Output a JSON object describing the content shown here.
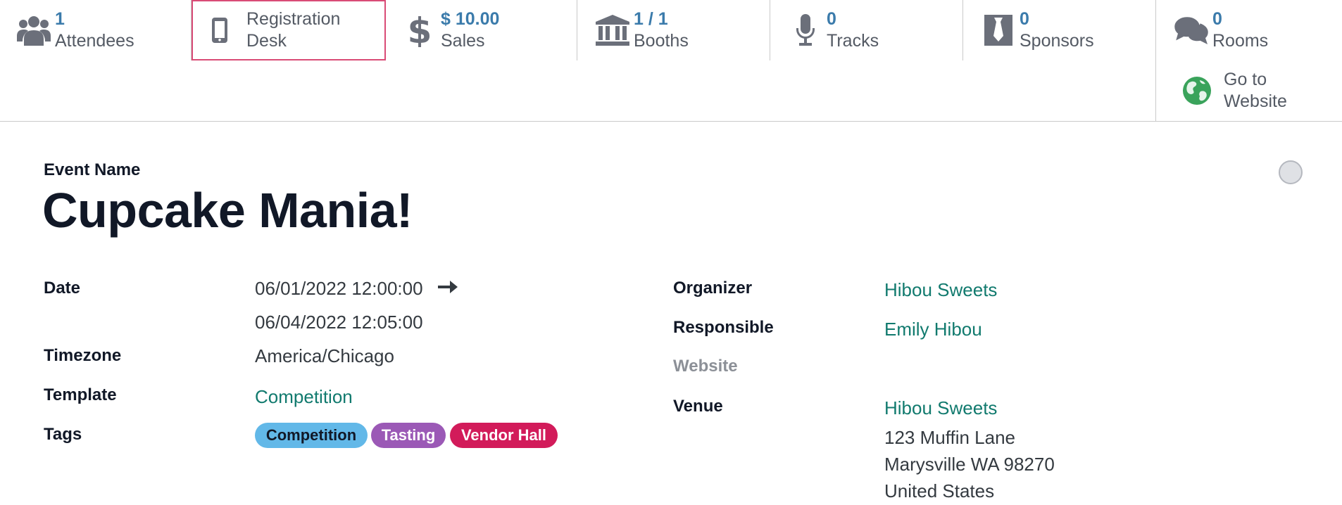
{
  "smart_buttons": {
    "attendees": {
      "value": "1",
      "label": "Attendees",
      "icon": "users-icon"
    },
    "registration": {
      "label_line1": "Registration",
      "label_line2": "Desk",
      "icon": "mobile-phone-icon"
    },
    "sales": {
      "value": "$ 10.00",
      "label": "Sales",
      "icon": "dollar-icon"
    },
    "booths": {
      "value": "1 / 1",
      "label": "Booths",
      "icon": "bank-icon"
    },
    "tracks": {
      "value": "0",
      "label": "Tracks",
      "icon": "microphone-icon"
    },
    "sponsors": {
      "value": "0",
      "label": "Sponsors",
      "icon": "black-tie-icon"
    },
    "rooms": {
      "value": "0",
      "label": "Rooms",
      "icon": "comments-icon"
    },
    "website": {
      "label_line1": "Go to",
      "label_line2": "Website",
      "icon": "globe-icon"
    }
  },
  "form": {
    "name_caption": "Event Name",
    "event_name": "Cupcake Mania!",
    "date_label": "Date",
    "date_begin": "06/01/2022 12:00:00",
    "date_end": "06/04/2022 12:05:00",
    "timezone_label": "Timezone",
    "timezone": "America/Chicago",
    "template_label": "Template",
    "template": "Competition",
    "tags_label": "Tags",
    "tags": [
      {
        "name": "Competition",
        "color": "#62b8e8",
        "text_color": "#111827"
      },
      {
        "name": "Tasting",
        "color": "#9b59b6",
        "text_color": "#ffffff"
      },
      {
        "name": "Vendor Hall",
        "color": "#d21b5a",
        "text_color": "#ffffff"
      }
    ],
    "organizer_label": "Organizer",
    "organizer": "Hibou Sweets",
    "responsible_label": "Responsible",
    "responsible": "Emily Hibou",
    "website_label": "Website",
    "venue_label": "Venue",
    "venue_name": "Hibou Sweets",
    "venue_street": "123 Muffin Lane",
    "venue_city": "Marysville WA 98270",
    "venue_country": "United States"
  },
  "colors": {
    "accent_value": "#3b7bab",
    "link": "#117a6e",
    "selected_border": "#d94b76"
  }
}
